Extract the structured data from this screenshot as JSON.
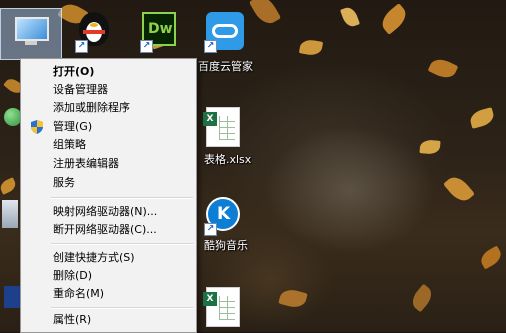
{
  "desktop": {
    "icons": [
      {
        "id": "computer",
        "label": ""
      },
      {
        "id": "qq",
        "label": ""
      },
      {
        "id": "dreamweaver",
        "label": "",
        "glyph": "Dw"
      },
      {
        "id": "baidu-cloud",
        "label": "百度云管家"
      },
      {
        "id": "xlsx-file",
        "label": "表格.xlsx"
      },
      {
        "id": "kugou",
        "label": "酷狗音乐",
        "glyph": "K"
      },
      {
        "id": "xlsx-file-2",
        "label": ""
      }
    ]
  },
  "context_menu": {
    "items": [
      {
        "label": "打开(O)",
        "bold": true
      },
      {
        "label": "设备管理器"
      },
      {
        "label": "添加或删除程序"
      },
      {
        "label": "管理(G)",
        "shield": true
      },
      {
        "label": "组策略"
      },
      {
        "label": "注册表编辑器"
      },
      {
        "label": "服务"
      },
      {
        "label": "映射网络驱动器(N)..."
      },
      {
        "label": "断开网络驱动器(C)..."
      },
      {
        "label": "创建快捷方式(S)"
      },
      {
        "label": "删除(D)"
      },
      {
        "label": "重命名(M)"
      },
      {
        "label": "属性(R)"
      }
    ]
  },
  "colors": {
    "menu_bg": "#f2f2f2",
    "menu_border": "#979797",
    "dw_green": "#8fd14f",
    "baidu_blue": "#2f9be8",
    "excel_green": "#1e7145",
    "kugou_blue": "#0d7ed6"
  }
}
